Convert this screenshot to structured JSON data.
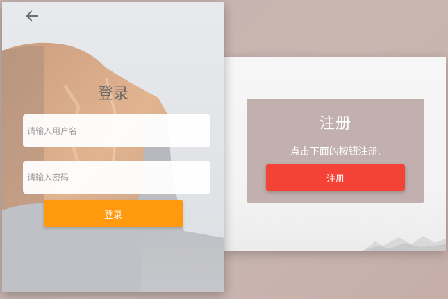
{
  "login": {
    "title": "登录",
    "username_placeholder": "请输入用户名",
    "password_placeholder": "请输入密码",
    "submit_label": "登录",
    "back_icon": "arrow-left-icon"
  },
  "register": {
    "title": "注册",
    "description": "点击下面的按钮注册.",
    "button_label": "注册"
  },
  "colors": {
    "login_button": "#ff9a0e",
    "register_button": "#f44336",
    "register_card": "#af9694",
    "page_background": "#c4b2ae"
  }
}
